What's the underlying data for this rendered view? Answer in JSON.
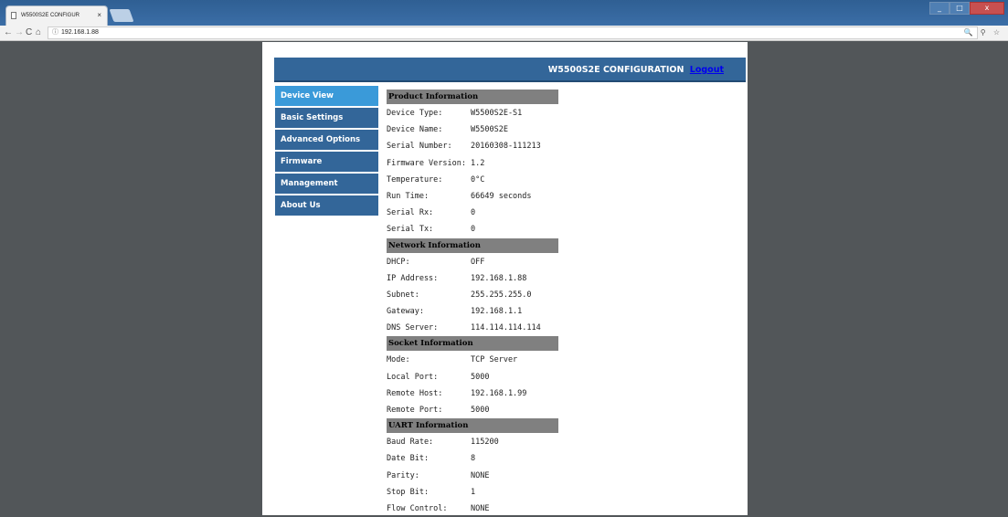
{
  "browser": {
    "tab_title": "W5500S2E CONFIGUR",
    "tab_close": "×",
    "url": "192.168.1.88",
    "info_icon": "ⓘ",
    "nav_back": "←",
    "nav_forward": "→",
    "nav_reload": "C",
    "nav_home": "⌂",
    "toolbar_right": "🔍 ⚲ ☆"
  },
  "header": {
    "title": "W5500S2E CONFIGURATION",
    "logout": "Logout"
  },
  "sidebar": {
    "items": [
      {
        "label": "Device View"
      },
      {
        "label": "Basic Settings"
      },
      {
        "label": "Advanced Options"
      },
      {
        "label": "Firmware"
      },
      {
        "label": "Management"
      },
      {
        "label": "About Us"
      }
    ]
  },
  "sections": {
    "product": {
      "title": "Product Information",
      "rows": [
        {
          "label": "Device Type:",
          "value": "W5500S2E-S1"
        },
        {
          "label": "Device Name:",
          "value": "W5500S2E"
        },
        {
          "label": "Serial Number:",
          "value": "20160308-111213"
        },
        {
          "label": "Firmware Version:",
          "value": "1.2"
        },
        {
          "label": "Temperature:",
          "value": "0°C"
        },
        {
          "label": "Run Time:",
          "value": "66649 seconds"
        },
        {
          "label": "Serial Rx:",
          "value": "0"
        },
        {
          "label": "Serial Tx:",
          "value": "0"
        }
      ]
    },
    "network": {
      "title": "Network Information",
      "rows": [
        {
          "label": "DHCP:",
          "value": "OFF"
        },
        {
          "label": "IP Address:",
          "value": "192.168.1.88"
        },
        {
          "label": "Subnet:",
          "value": "255.255.255.0"
        },
        {
          "label": "Gateway:",
          "value": "192.168.1.1"
        },
        {
          "label": "DNS Server:",
          "value": "114.114.114.114"
        }
      ]
    },
    "socket": {
      "title": "Socket Information",
      "rows": [
        {
          "label": "Mode:",
          "value": "TCP Server"
        },
        {
          "label": "Local Port:",
          "value": "5000"
        },
        {
          "label": "Remote Host:",
          "value": "192.168.1.99"
        },
        {
          "label": "Remote Port:",
          "value": "5000"
        }
      ]
    },
    "uart": {
      "title": "UART Information",
      "rows": [
        {
          "label": "Baud Rate:",
          "value": "115200"
        },
        {
          "label": "Date Bit:",
          "value": "8"
        },
        {
          "label": "Parity:",
          "value": "NONE"
        },
        {
          "label": "Stop Bit:",
          "value": "1"
        },
        {
          "label": "Flow Control:",
          "value": "NONE"
        }
      ]
    }
  }
}
